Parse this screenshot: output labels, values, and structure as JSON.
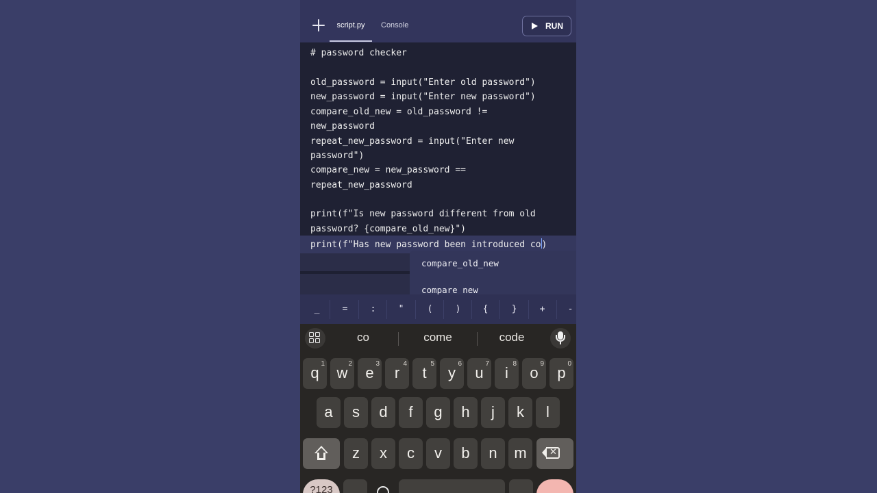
{
  "header": {
    "tabs": [
      {
        "label": "script.py",
        "active": true
      },
      {
        "label": "Console",
        "active": false
      }
    ],
    "run_label": "RUN"
  },
  "editor": {
    "lines": [
      "# password checker",
      "",
      "old_password = input(\"Enter old password\")",
      "new_password = input(\"Enter new password\")",
      "compare_old_new = old_password !=",
      "new_password",
      "repeat_new_password = input(\"Enter new",
      "password\")",
      "compare_new = new_password ==",
      "repeat_new_password",
      "",
      "print(f\"Is new password different from old",
      "password? {compare_old_new}\")"
    ],
    "current_line_before_cursor": "print(f\"Has new password been introduced co",
    "current_line_after_cursor": ")"
  },
  "autocomplete": {
    "items": [
      "compare_old_new",
      "compare_new"
    ]
  },
  "symbol_bar": [
    "_",
    "=",
    ":",
    "\"",
    "(",
    ")",
    "{",
    "}",
    "+",
    "-"
  ],
  "keyboard": {
    "suggestions": [
      "co",
      "come",
      "code"
    ],
    "rows": [
      [
        {
          "k": "q",
          "n": "1"
        },
        {
          "k": "w",
          "n": "2"
        },
        {
          "k": "e",
          "n": "3"
        },
        {
          "k": "r",
          "n": "4"
        },
        {
          "k": "t",
          "n": "5"
        },
        {
          "k": "y",
          "n": "6"
        },
        {
          "k": "u",
          "n": "7"
        },
        {
          "k": "i",
          "n": "8"
        },
        {
          "k": "o",
          "n": "9"
        },
        {
          "k": "p",
          "n": "0"
        }
      ],
      [
        {
          "k": "a"
        },
        {
          "k": "s"
        },
        {
          "k": "d"
        },
        {
          "k": "f"
        },
        {
          "k": "g"
        },
        {
          "k": "h"
        },
        {
          "k": "j"
        },
        {
          "k": "k"
        },
        {
          "k": "l"
        }
      ],
      [
        {
          "k": "z"
        },
        {
          "k": "x"
        },
        {
          "k": "c"
        },
        {
          "k": "v"
        },
        {
          "k": "b"
        },
        {
          "k": "n"
        },
        {
          "k": "m"
        }
      ]
    ],
    "numsym_label": "?123"
  },
  "colors": {
    "background": "#3a3e68",
    "editor_bg": "#1f2133",
    "accent_cursor": "#7fa7ff",
    "keyboard_bg": "#282624",
    "enter_key": "#f3b6b0"
  }
}
